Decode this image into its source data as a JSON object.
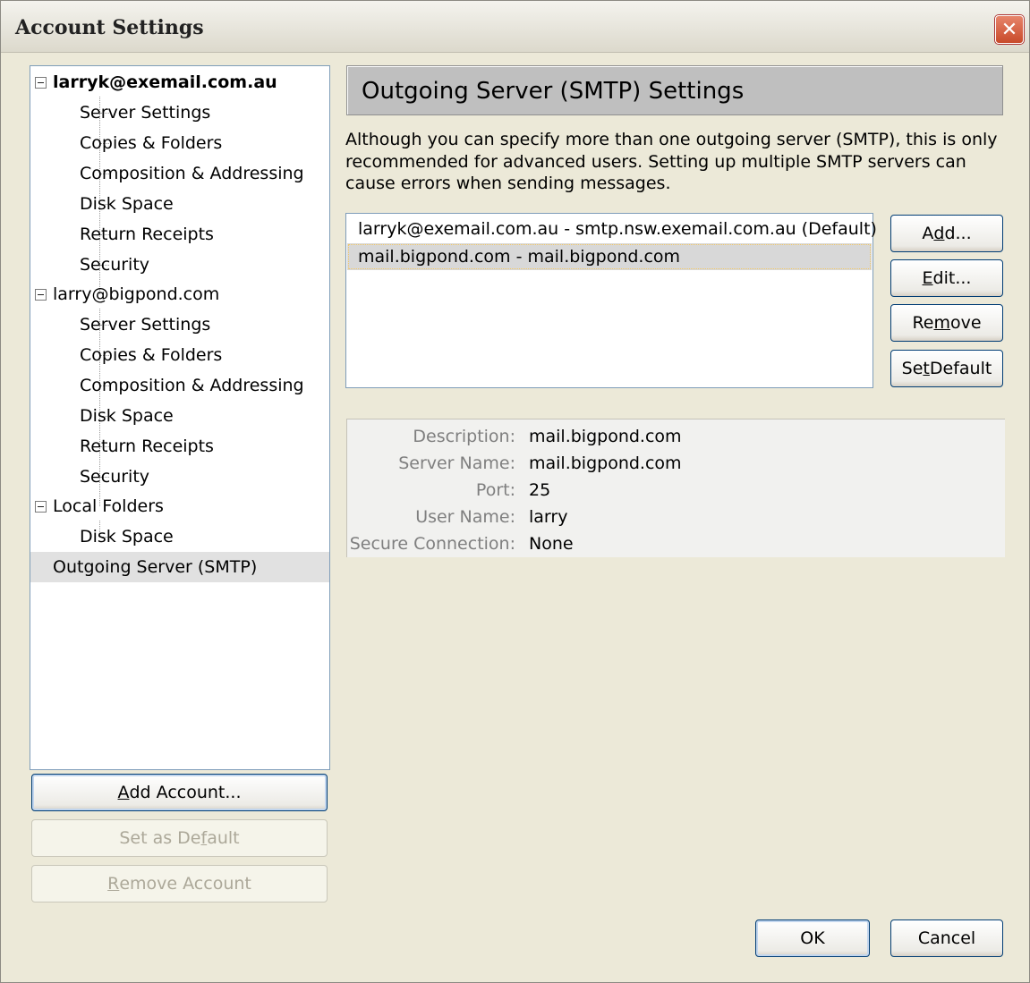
{
  "window": {
    "title": "Account Settings",
    "close_glyph": "✕"
  },
  "tree": {
    "accounts": [
      {
        "name": "larryk@exemail.com.au",
        "items": [
          "Server Settings",
          "Copies & Folders",
          "Composition & Addressing",
          "Disk Space",
          "Return Receipts",
          "Security"
        ]
      },
      {
        "name": "larry@bigpond.com",
        "items": [
          "Server Settings",
          "Copies & Folders",
          "Composition & Addressing",
          "Disk Space",
          "Return Receipts",
          "Security"
        ]
      },
      {
        "name": "Local Folders",
        "items": [
          "Disk Space"
        ]
      }
    ],
    "selected_item": "Outgoing Server (SMTP)"
  },
  "left_buttons": {
    "add_account": {
      "pre": "",
      "key": "A",
      "post": "dd Account..."
    },
    "set_default": {
      "pre": "Set as De",
      "key": "f",
      "post": "ault"
    },
    "remove_account": {
      "pre": "",
      "key": "R",
      "post": "emove Account"
    }
  },
  "panel": {
    "header": "Outgoing Server (SMTP) Settings",
    "description": "Although you can specify more than one outgoing server (SMTP), this is only recommended for advanced users. Setting up multiple SMTP servers can cause errors when sending messages.",
    "servers": [
      "larryk@exemail.com.au - smtp.nsw.exemail.com.au (Default)",
      "mail.bigpond.com - mail.bigpond.com"
    ],
    "buttons": {
      "add": {
        "pre": "A",
        "key": "d",
        "post": "d..."
      },
      "edit": {
        "pre": "",
        "key": "E",
        "post": "dit..."
      },
      "remove": {
        "pre": "Re",
        "key": "m",
        "post": "ove"
      },
      "set_default": {
        "pre": "Se",
        "key": "t",
        "post": " Default"
      }
    },
    "details": {
      "description_label": "Description:",
      "description_value": "mail.bigpond.com",
      "server_name_label": "Server Name:",
      "server_name_value": "mail.bigpond.com",
      "port_label": "Port:",
      "port_value": "25",
      "user_name_label": "User Name:",
      "user_name_value": "larry",
      "secure_label": "Secure Connection:",
      "secure_value": "None"
    }
  },
  "dialog_buttons": {
    "ok": "OK",
    "cancel": "Cancel"
  },
  "colors": {
    "window_bg": "#ece9d8",
    "header_bg": "#bfbfbf",
    "selection_bg": "#d8d8d8",
    "close_red": "#c84a2a"
  }
}
